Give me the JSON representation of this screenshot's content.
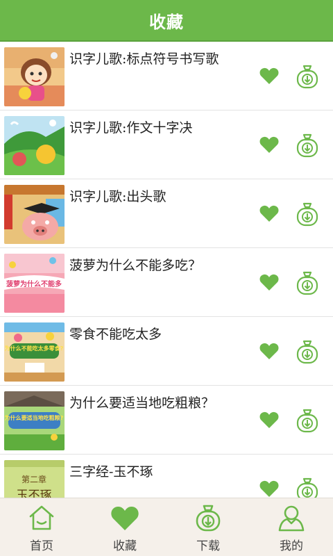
{
  "header": {
    "title": "收藏"
  },
  "colors": {
    "accent": "#6cb84a",
    "tabbar_bg": "#f5f0ea"
  },
  "items": [
    {
      "title": "识字儿歌:标点符号书写歌",
      "thumb_icon": "cartoon-girl-thumbnail"
    },
    {
      "title": "识字儿歌:作文十字决",
      "thumb_icon": "garden-scene-thumbnail"
    },
    {
      "title": "识字儿歌:出头歌",
      "thumb_icon": "pig-graduate-thumbnail"
    },
    {
      "title": "菠萝为什么不能多吃？",
      "thumb_icon": "pineapple-title-thumbnail",
      "thumb_text": "菠萝为什么不能多"
    },
    {
      "title": "零食不能吃太多",
      "thumb_icon": "snack-title-thumbnail",
      "thumb_text": "为什么不能吃太多零食?"
    },
    {
      "title": "为什么要适当地吃粗粮？",
      "thumb_icon": "grain-title-thumbnail",
      "thumb_text": "为什么要适当地吃粗粮?"
    },
    {
      "title": "三字经-玉不琢",
      "thumb_icon": "chapter-two-thumbnail",
      "thumb_text": "第二章",
      "thumb_text2": "玉不琢"
    }
  ],
  "tabs": [
    {
      "label": "首页",
      "icon": "home-icon"
    },
    {
      "label": "收藏",
      "icon": "heart-icon"
    },
    {
      "label": "下载",
      "icon": "download-bag-icon"
    },
    {
      "label": "我的",
      "icon": "user-icon"
    }
  ]
}
